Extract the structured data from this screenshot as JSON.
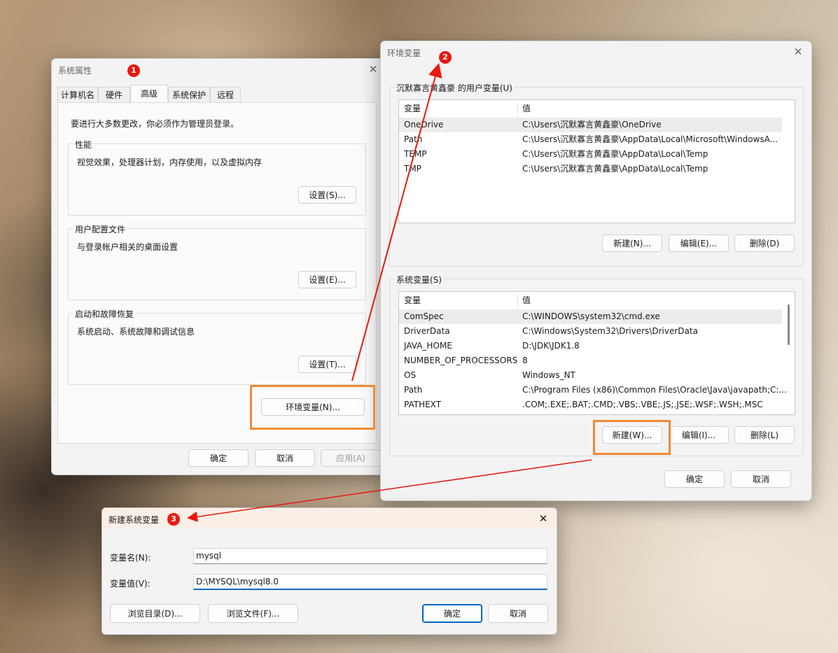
{
  "colors": {
    "accent": "#0067c0",
    "annotation_red": "#e8180f",
    "highlight_orange": "#f08a33"
  },
  "sys_props": {
    "title": "系统属性",
    "tabs": [
      "计算机名",
      "硬件",
      "高级",
      "系统保护",
      "远程"
    ],
    "active_tab": "高级",
    "admin_note": "要进行大多数更改，你必须作为管理员登录。",
    "perf": {
      "label": "性能",
      "desc": "视觉效果，处理器计划，内存使用，以及虚拟内存",
      "button": "设置(S)..."
    },
    "profile": {
      "label": "用户配置文件",
      "desc": "与登录帐户相关的桌面设置",
      "button": "设置(E)..."
    },
    "startup": {
      "label": "启动和故障恢复",
      "desc": "系统启动、系统故障和调试信息",
      "button": "设置(T)..."
    },
    "env_button": "环境变量(N)...",
    "ok": "确定",
    "cancel": "取消",
    "apply": "应用(A)",
    "close": "✕"
  },
  "env_vars": {
    "title": "环境变量",
    "user_group": "沉默寡言黄鑫豪 的用户变量(U)",
    "col_name": "变量",
    "col_value": "值",
    "user_rows": [
      {
        "name": "OneDrive",
        "value": "C:\\Users\\沉默寡言黄鑫豪\\OneDrive"
      },
      {
        "name": "Path",
        "value": "C:\\Users\\沉默寡言黄鑫豪\\AppData\\Local\\Microsoft\\WindowsA..."
      },
      {
        "name": "TEMP",
        "value": "C:\\Users\\沉默寡言黄鑫豪\\AppData\\Local\\Temp"
      },
      {
        "name": "TMP",
        "value": "C:\\Users\\沉默寡言黄鑫豪\\AppData\\Local\\Temp"
      }
    ],
    "user_new": "新建(N)...",
    "user_edit": "编辑(E)...",
    "user_delete": "删除(D)",
    "sys_group": "系统变量(S)",
    "sys_rows": [
      {
        "name": "ComSpec",
        "value": "C:\\WINDOWS\\system32\\cmd.exe"
      },
      {
        "name": "DriverData",
        "value": "C:\\Windows\\System32\\Drivers\\DriverData"
      },
      {
        "name": "JAVA_HOME",
        "value": "D:\\JDK\\JDK1.8"
      },
      {
        "name": "NUMBER_OF_PROCESSORS",
        "value": "8"
      },
      {
        "name": "OS",
        "value": "Windows_NT"
      },
      {
        "name": "Path",
        "value": "C:\\Program Files (x86)\\Common Files\\Oracle\\Java\\javapath;C:..."
      },
      {
        "name": "PATHEXT",
        "value": ".COM;.EXE;.BAT;.CMD;.VBS;.VBE;.JS;.JSE;.WSF;.WSH;.MSC"
      }
    ],
    "sys_new": "新建(W)...",
    "sys_edit": "编辑(I)...",
    "sys_delete": "删除(L)",
    "ok": "确定",
    "cancel": "取消",
    "close": "✕"
  },
  "new_var": {
    "title": "新建系统变量",
    "name_label": "变量名(N):",
    "name_value": "mysql",
    "value_label": "变量值(V):",
    "value_value": "D:\\MYSQL\\mysql8.0",
    "browse_dir": "浏览目录(D)...",
    "browse_file": "浏览文件(F)...",
    "ok": "确定",
    "cancel": "取消",
    "close": "✕"
  },
  "annotations": {
    "step1": "1",
    "step2": "2",
    "step3": "3"
  }
}
